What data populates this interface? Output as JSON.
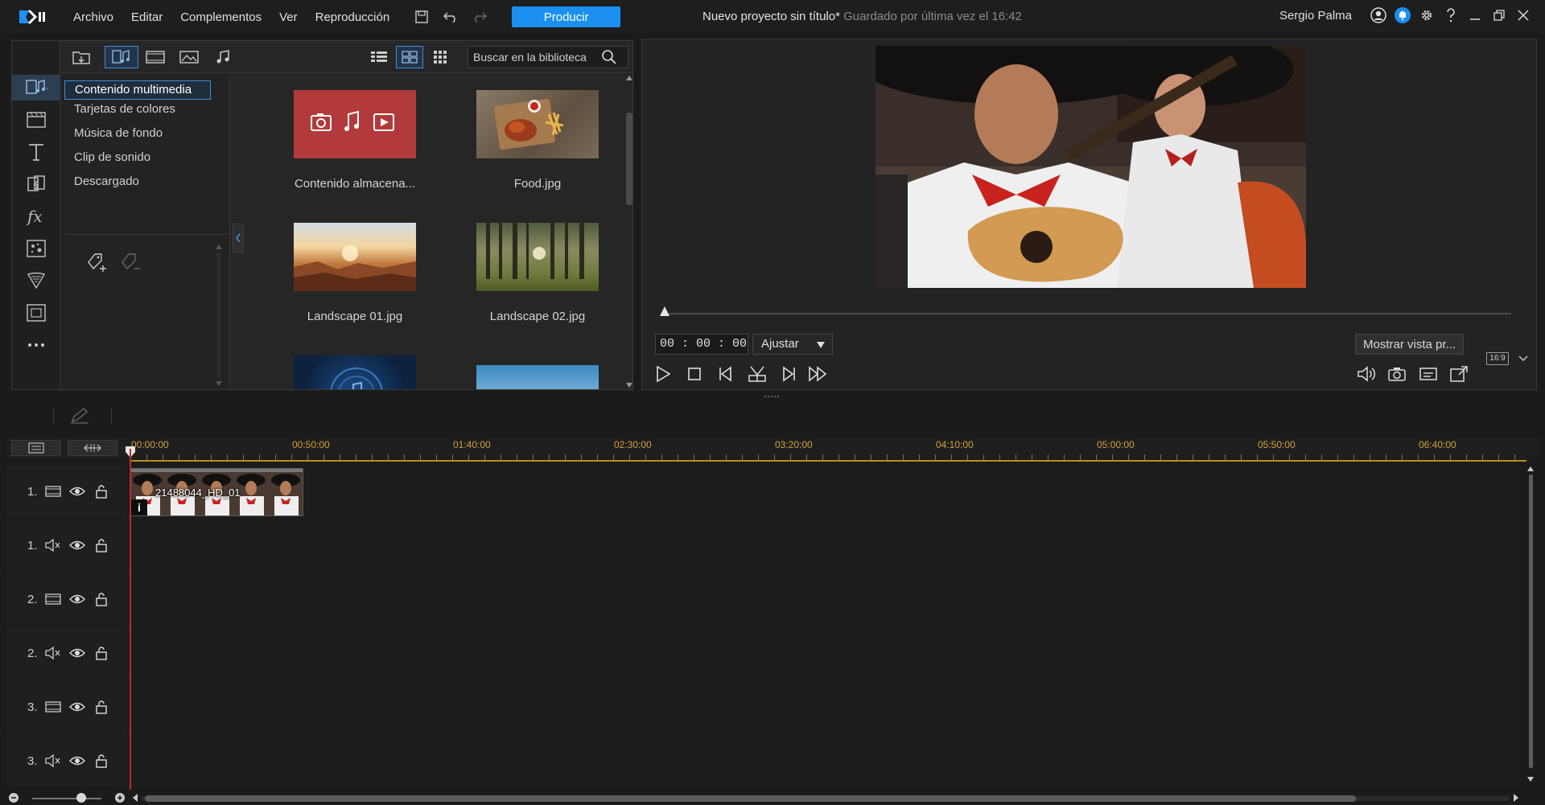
{
  "menu": {
    "items": [
      "Archivo",
      "Editar",
      "Complementos",
      "Ver",
      "Reproducción"
    ],
    "produce_label": "Producir"
  },
  "title": {
    "project": "Nuevo proyecto sin título*",
    "saved": " Guardado por última vez el 16:42"
  },
  "user": {
    "name": "Sergio Palma"
  },
  "library": {
    "search_placeholder": "Buscar en la biblioteca",
    "tree": [
      "Contenido multimedia",
      "Tarjetas de colores",
      "Música de fondo",
      "Clip de sonido",
      "Descargado"
    ],
    "media": [
      {
        "label": "Contenido almacena..."
      },
      {
        "label": "Food.jpg"
      },
      {
        "label": "Landscape 01.jpg"
      },
      {
        "label": "Landscape 02.jpg"
      }
    ]
  },
  "preview": {
    "timecode": "00 : 00 : 00 : 00",
    "fit": "Ajustar",
    "show_preview": "Mostrar vista pr...",
    "aspect": "16:9"
  },
  "timeline": {
    "ruler": [
      "00:00:00",
      "00:50:00",
      "01:40:00",
      "02:30:00",
      "03:20:00",
      "04:10:00",
      "05:00:00",
      "05:50:00",
      "06:40:00"
    ],
    "tracks": [
      {
        "num": "1.",
        "kind": "video"
      },
      {
        "num": "1.",
        "kind": "audio"
      },
      {
        "num": "2.",
        "kind": "video"
      },
      {
        "num": "2.",
        "kind": "audio"
      },
      {
        "num": "3.",
        "kind": "video"
      },
      {
        "num": "3.",
        "kind": "audio"
      }
    ],
    "clip_label": "21488044_HD_01",
    "clip_info": "i"
  },
  "colors": {
    "accent": "#1a8ff0",
    "playhead": "#c0282d",
    "ruler": "#cfa23a"
  }
}
